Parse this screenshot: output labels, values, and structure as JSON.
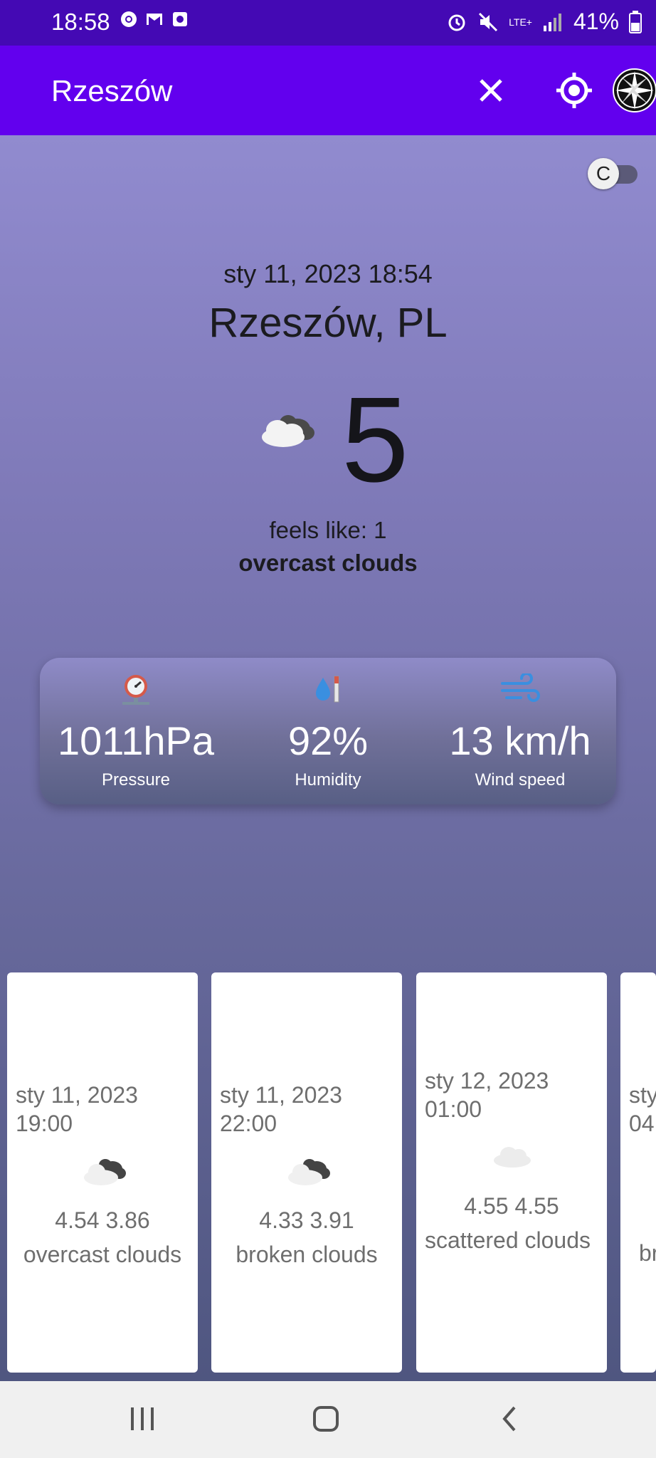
{
  "status_bar": {
    "time": "18:58",
    "battery": "41%",
    "network": "LTE+"
  },
  "toolbar": {
    "title": "Rzeszów",
    "close_icon": "close-icon",
    "location_icon": "my-location-icon",
    "compass_icon": "compass-icon"
  },
  "unit_toggle": {
    "label": "C",
    "checked": false
  },
  "current": {
    "datetime": "sty 11, 2023 18:54",
    "city": "Rzeszów, PL",
    "temperature": "5",
    "feels_like": "feels like: 1",
    "description": "overcast clouds"
  },
  "stats": [
    {
      "value": "1011hPa",
      "label": "Pressure",
      "icon": "barometer-icon"
    },
    {
      "value": "92%",
      "label": "Humidity",
      "icon": "humidity-icon"
    },
    {
      "value": "13 km/h",
      "label": "Wind speed",
      "icon": "wind-icon"
    }
  ],
  "forecast": [
    {
      "date": "sty 11, 2023",
      "time": "19:00",
      "values": "4.54 3.86",
      "description": "overcast clouds"
    },
    {
      "date": "sty 11, 2023",
      "time": "22:00",
      "values": "4.33 3.91",
      "description": "broken clouds"
    },
    {
      "date": "sty 12, 2023",
      "time": "01:00",
      "values": "4.55 4.55",
      "description": "scattered clouds"
    },
    {
      "date": "sty",
      "time": "04",
      "values": "",
      "description": "br"
    }
  ],
  "nav": {
    "recent": "recent-apps",
    "home": "home",
    "back": "back"
  },
  "colors": {
    "status_bar": "#4409b4",
    "toolbar": "#6200ee",
    "gradient_top": "#918bcf",
    "gradient_bottom": "#4f5680"
  }
}
